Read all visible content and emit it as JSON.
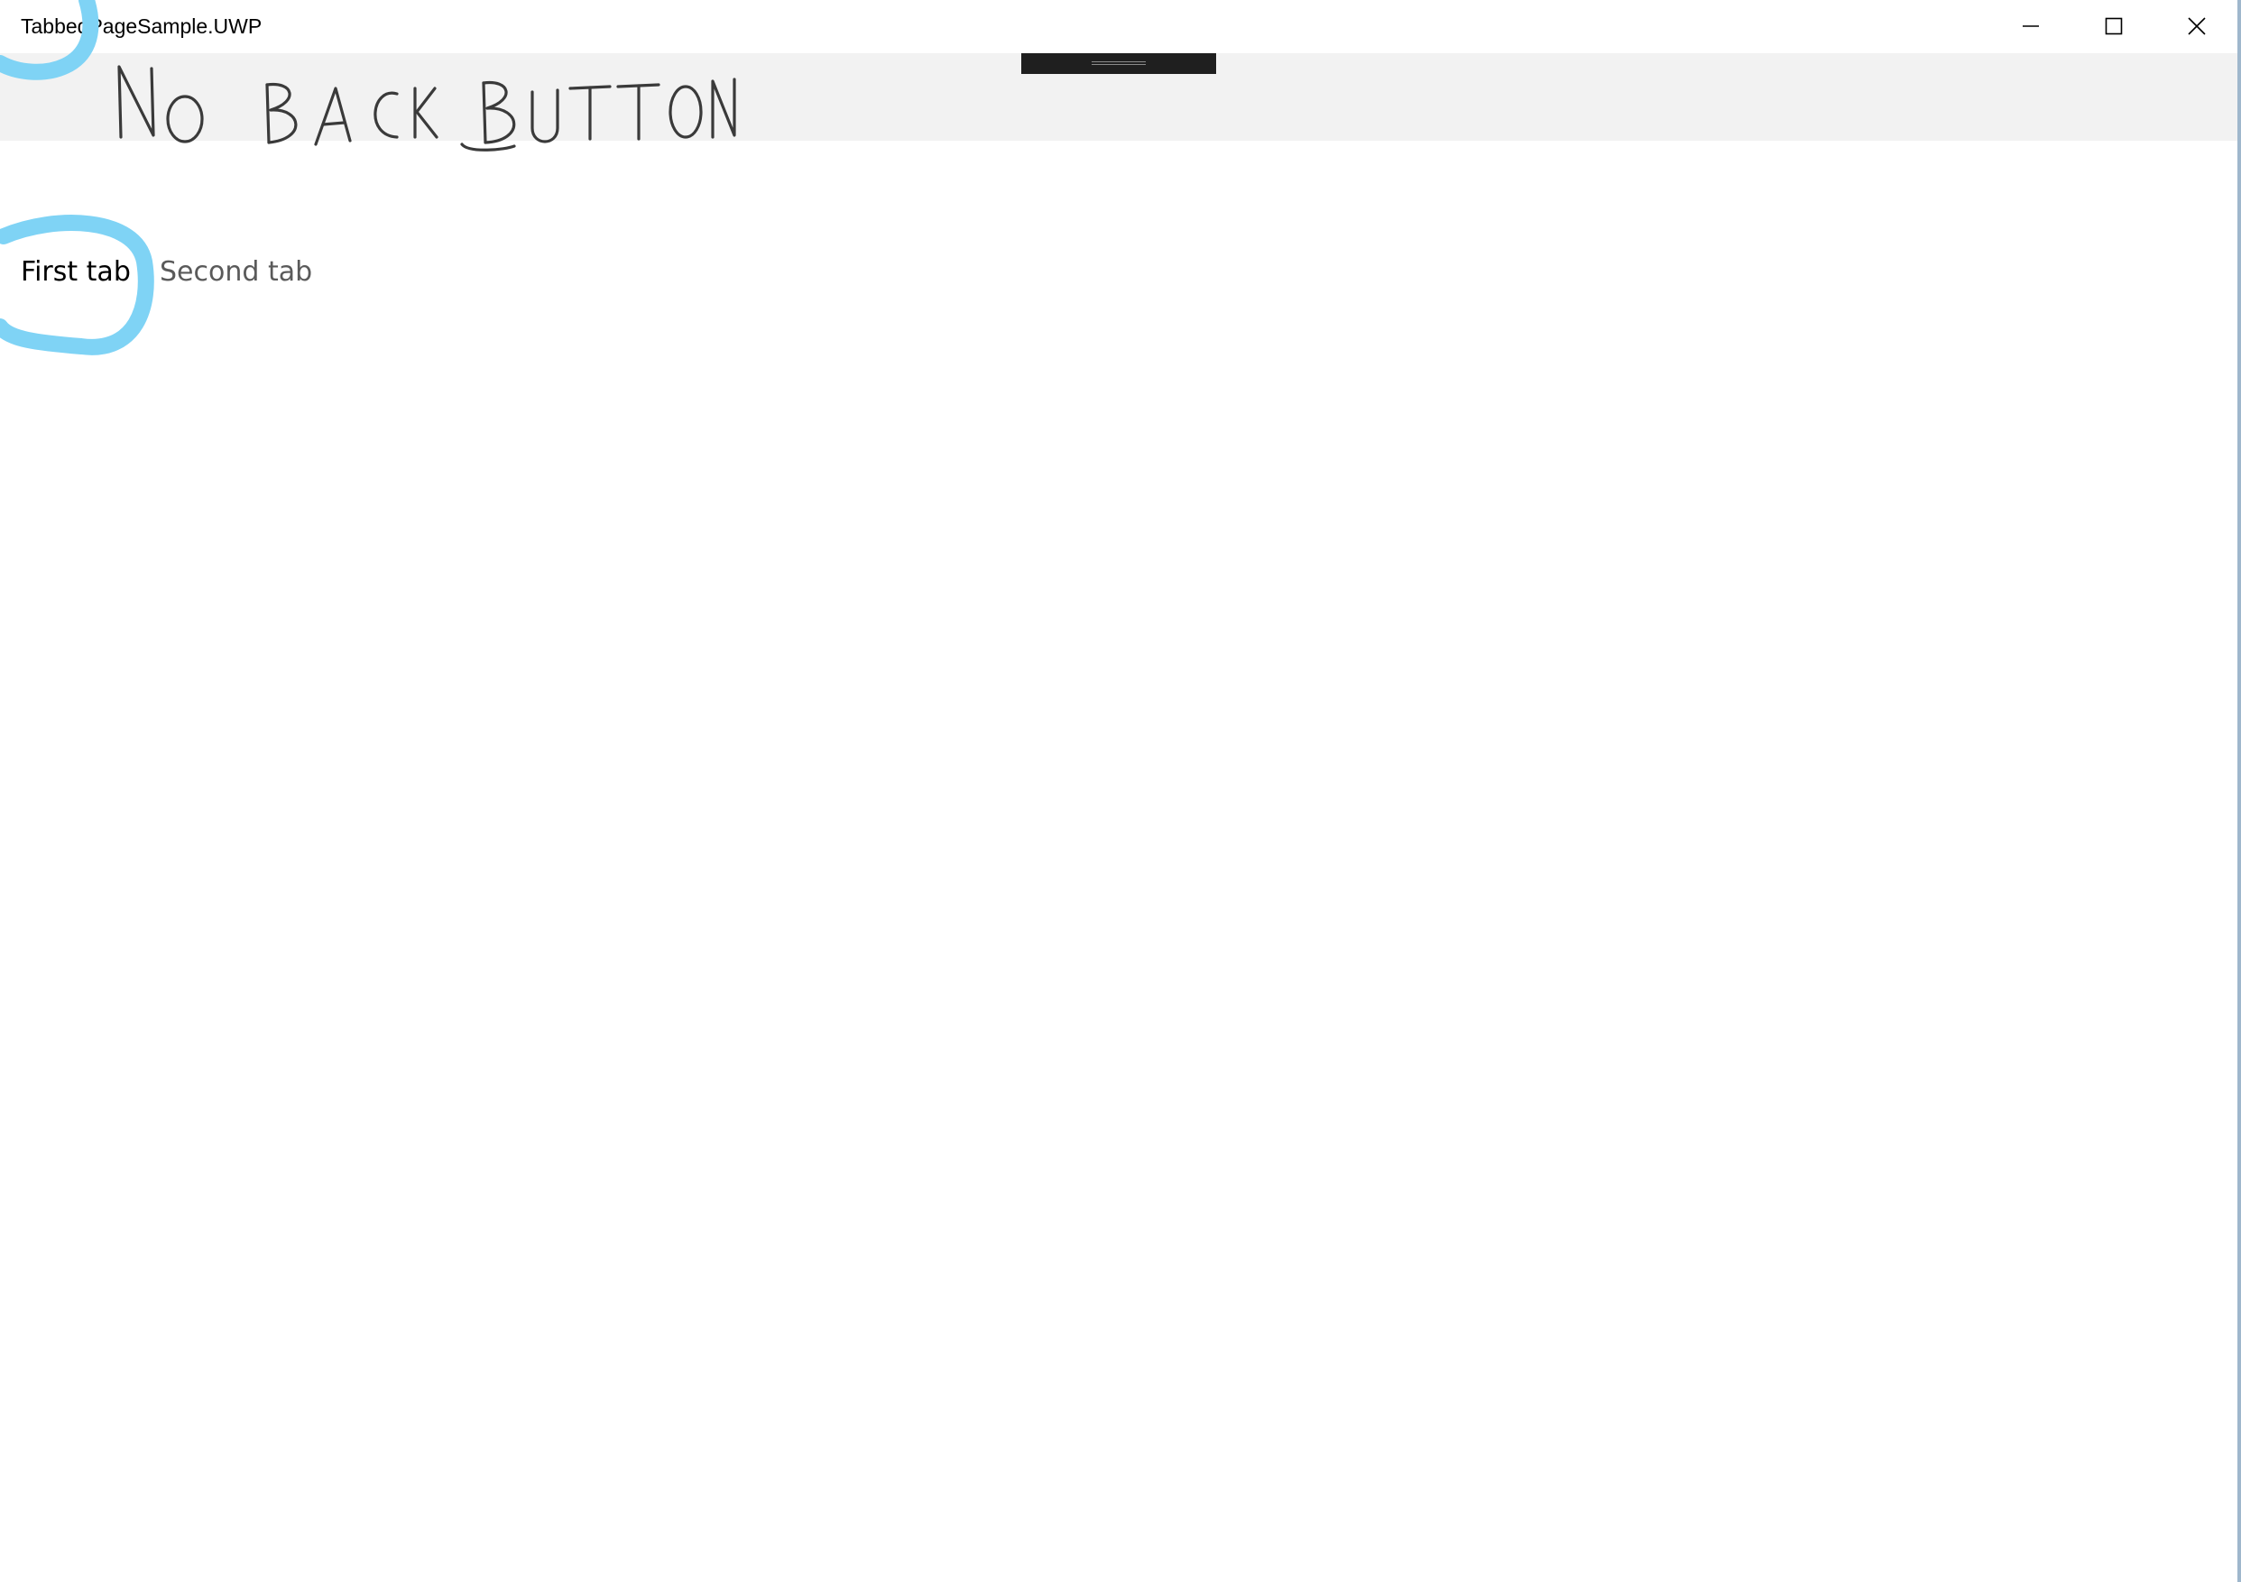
{
  "window": {
    "title": "TabbedPageSample.UWP",
    "controls": {
      "minimize_icon": "minimize-icon",
      "maximize_icon": "maximize-icon",
      "close_icon": "close-icon"
    }
  },
  "annotation": {
    "handwritten_note": "NO BACK BUTTON",
    "marker_color": "#7fd3f5"
  },
  "tabs": [
    {
      "label": "First tab",
      "selected": true
    },
    {
      "label": "Second tab",
      "selected": false
    }
  ],
  "colors": {
    "navbar_bg": "#f2f2f2",
    "drag_handle": "#1f1f1f",
    "selected_tab_text": "#000000",
    "unselected_tab_text": "#5a5a5a"
  }
}
